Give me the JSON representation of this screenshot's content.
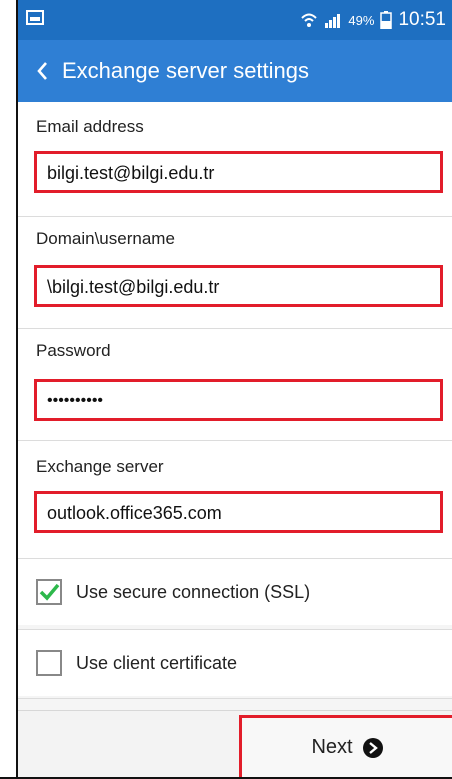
{
  "status_bar": {
    "battery_pct": "49%",
    "time": "10:51"
  },
  "app_bar": {
    "title": "Exchange server settings"
  },
  "form": {
    "email": {
      "label": "Email address",
      "value": "bilgi.test@bilgi.edu.tr"
    },
    "domain_username": {
      "label": "Domain\\username",
      "value": "\\bilgi.test@bilgi.edu.tr"
    },
    "password": {
      "label": "Password",
      "value": "••••••••••"
    },
    "exchange_server": {
      "label": "Exchange server",
      "value": "outlook.office365.com"
    }
  },
  "options": {
    "ssl": {
      "label": "Use secure connection (SSL)",
      "checked": true
    },
    "client_cert": {
      "label": "Use client certificate",
      "checked": false
    }
  },
  "actions": {
    "next_label": "Next"
  },
  "colors": {
    "status_bar": "#1e6fc1",
    "app_bar": "#2f7fd4",
    "highlight_border": "#e21d2a",
    "check_green": "#2db84b"
  }
}
